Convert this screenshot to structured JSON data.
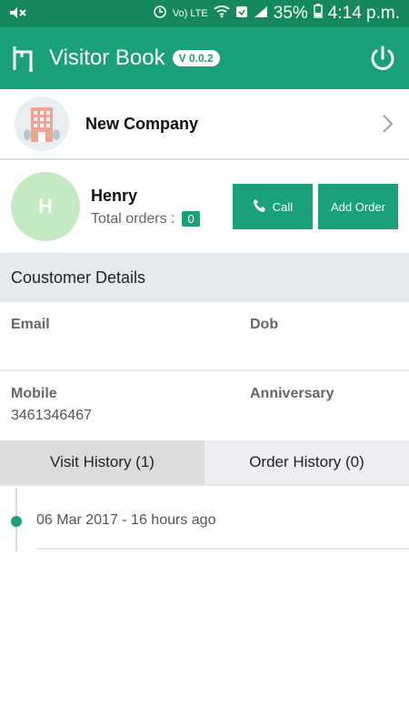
{
  "status_bar": {
    "battery": "35%",
    "time": "4:14 p.m.",
    "network": "Vo) LTE",
    "colors": {
      "background": "#15885e"
    }
  },
  "app_bar": {
    "title": "Visitor Book",
    "version": "V 0.0.2",
    "colors": {
      "background": "#1aa07a"
    }
  },
  "company": {
    "name": "New Company"
  },
  "customer": {
    "initial": "H",
    "name": "Henry",
    "total_orders_label": "Total orders :",
    "total_orders": "0",
    "call_label": "Call",
    "add_order_label": "Add Order"
  },
  "details": {
    "title": "Coustomer Details",
    "email_label": "Email",
    "email_value": "",
    "dob_label": "Dob",
    "dob_value": "",
    "mobile_label": "Mobile",
    "mobile_value": "3461346467",
    "anniversary_label": "Anniversary",
    "anniversary_value": ""
  },
  "tabs": [
    {
      "label": "Visit History (1)",
      "active": true
    },
    {
      "label": "Order History (0)",
      "active": false
    }
  ],
  "visits": [
    {
      "text": "06 Mar 2017 - 16 hours ago"
    }
  ],
  "icons": {
    "mute": "mute-icon",
    "alarm": "alarm-icon",
    "wifi": "wifi-icon",
    "signal": "signal-icon",
    "battery": "battery-icon",
    "logo": "visitor-book-logo-icon",
    "power": "power-icon",
    "company": "office-building-icon",
    "chevron": "chevron-right-icon",
    "phone": "phone-icon"
  }
}
